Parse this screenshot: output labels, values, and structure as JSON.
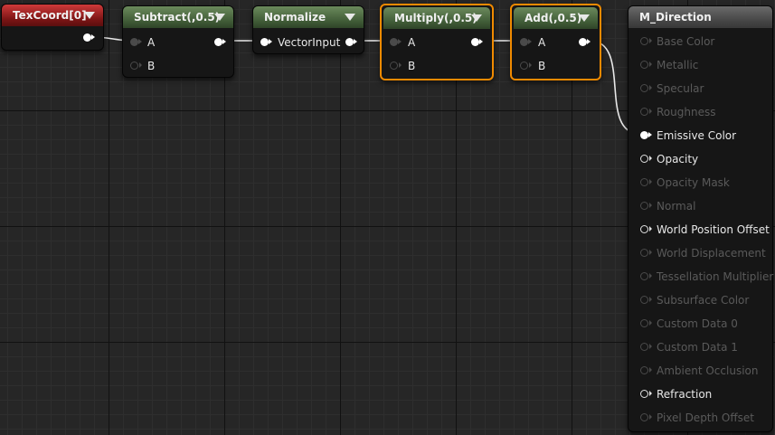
{
  "nodes": {
    "texcoord": {
      "title": "TexCoord[0]"
    },
    "subtract": {
      "title": "Subtract(,0.5)",
      "pin_a": "A",
      "pin_b": "B"
    },
    "normalize": {
      "title": "Normalize",
      "input": "VectorInput"
    },
    "multiply": {
      "title": "Multiply(,0.5)",
      "pin_a": "A",
      "pin_b": "B"
    },
    "add": {
      "title": "Add(,0.5)",
      "pin_a": "A",
      "pin_b": "B"
    }
  },
  "material": {
    "title": "M_Direction",
    "inputs": [
      {
        "label": "Base Color",
        "enabled": false
      },
      {
        "label": "Metallic",
        "enabled": false
      },
      {
        "label": "Specular",
        "enabled": false
      },
      {
        "label": "Roughness",
        "enabled": false
      },
      {
        "label": "Emissive Color",
        "enabled": true,
        "connected": true
      },
      {
        "label": "Opacity",
        "enabled": true
      },
      {
        "label": "Opacity Mask",
        "enabled": false
      },
      {
        "label": "Normal",
        "enabled": false
      },
      {
        "label": "World Position Offset",
        "enabled": true
      },
      {
        "label": "World Displacement",
        "enabled": false
      },
      {
        "label": "Tessellation Multiplier",
        "enabled": false
      },
      {
        "label": "Subsurface Color",
        "enabled": false
      },
      {
        "label": "Custom Data 0",
        "enabled": false
      },
      {
        "label": "Custom Data 1",
        "enabled": false
      },
      {
        "label": "Ambient Occlusion",
        "enabled": false
      },
      {
        "label": "Refraction",
        "enabled": true
      },
      {
        "label": "Pixel Depth Offset",
        "enabled": false
      }
    ]
  },
  "colors": {
    "selection": "#f08a00",
    "header_red": "#7a1414",
    "header_green": "#3f5a36",
    "header_gray": "#444444",
    "wire": "#e8e8e8"
  }
}
